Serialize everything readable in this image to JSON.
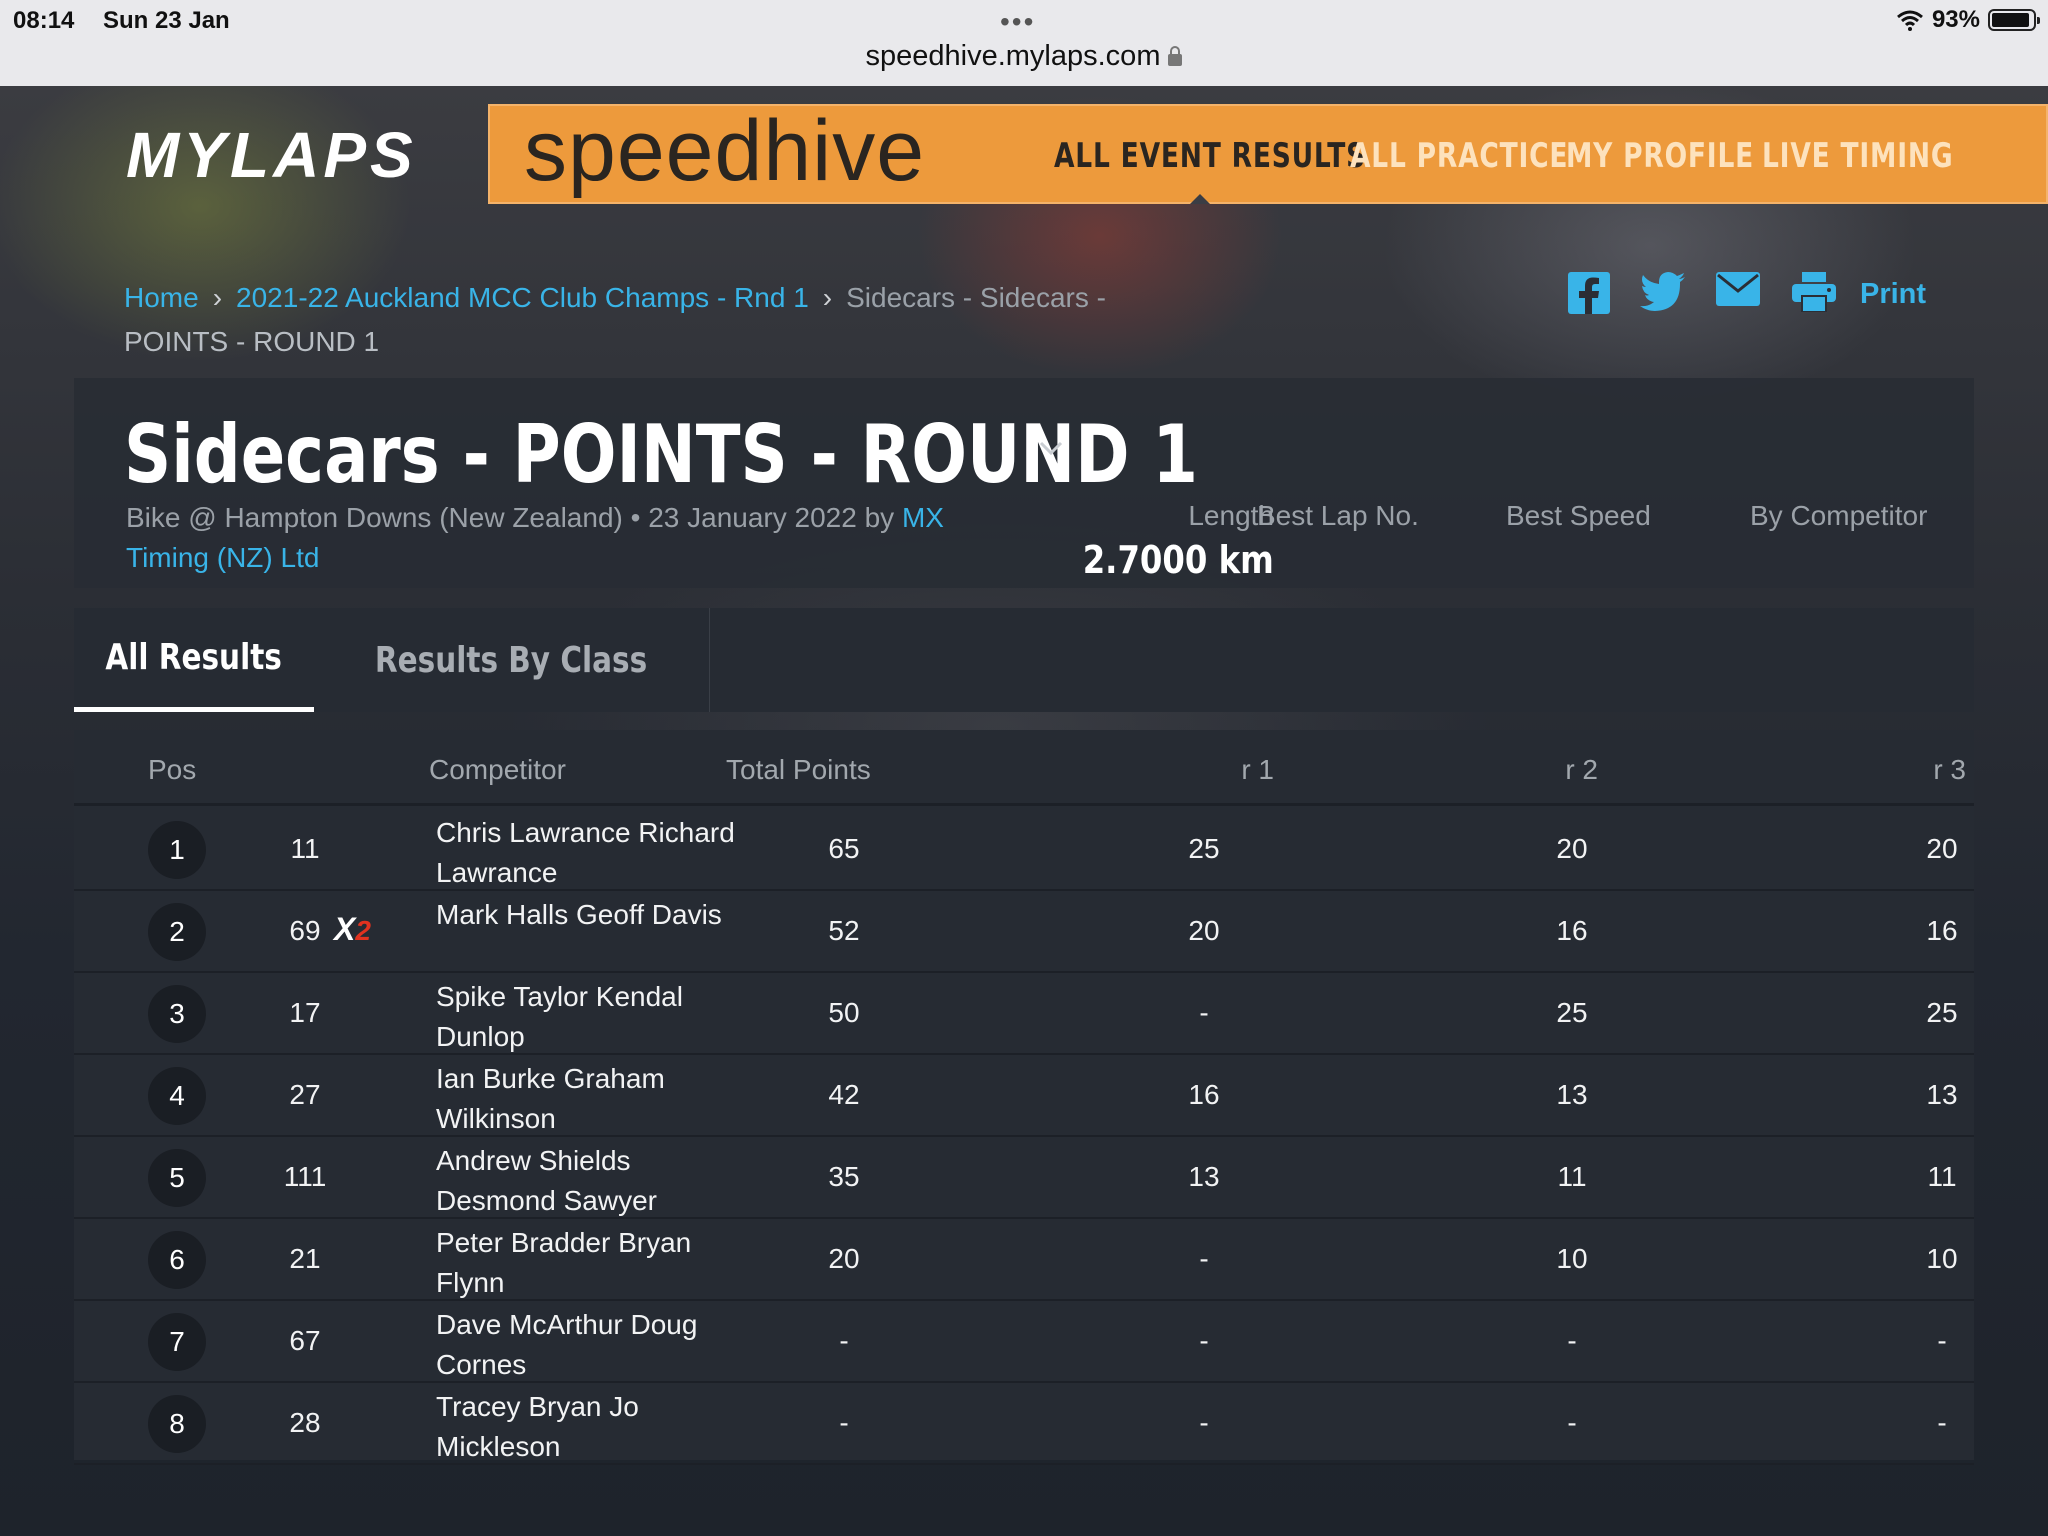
{
  "status_bar": {
    "time": "08:14",
    "date": "Sun 23 Jan",
    "dots": "•••",
    "battery": "93%",
    "battery_level": 0.93
  },
  "browser": {
    "url": "speedhive.mylaps.com"
  },
  "header": {
    "brand": "MYLAPS",
    "product": "speedhive",
    "nav": [
      "ALL EVENT RESULTS",
      "ALL PRACTICE",
      "MY PROFILE",
      "LIVE TIMING"
    ]
  },
  "breadcrumb": {
    "home": "Home",
    "event": "2021-22 Auckland MCC Club Champs - Rnd 1",
    "class": "Sidecars - Sidecars -",
    "current": "POINTS - ROUND 1"
  },
  "share": {
    "print_label": "Print"
  },
  "event": {
    "title": "Sidecars - POINTS - ROUND 1",
    "meta": "Bike @ Hampton Downs (New Zealand) • 23 January 2022 by",
    "organizer": "MX Timing (NZ) Ltd",
    "stats": {
      "length_label": "Length",
      "length_value": "2.7000 km",
      "best_lap_label": "Best Lap No.",
      "best_speed_label": "Best Speed",
      "by_competitor_label": "By Competitor"
    }
  },
  "tabs": [
    "All Results",
    "Results By Class"
  ],
  "table": {
    "headers": [
      "Pos",
      "Competitor",
      "Total Points",
      "r 1",
      "r 2",
      "r 3"
    ],
    "rows": [
      {
        "pos": "1",
        "number": "11",
        "badge": "",
        "badge_sub": "",
        "competitor": "Chris Lawrance Richard Lawrance",
        "total": "65",
        "r1": "25",
        "r2": "20",
        "r3": "20"
      },
      {
        "pos": "2",
        "number": "69",
        "badge": "X",
        "badge_sub": "2",
        "competitor": "Mark Halls Geoff Davis",
        "total": "52",
        "r1": "20",
        "r2": "16",
        "r3": "16"
      },
      {
        "pos": "3",
        "number": "17",
        "badge": "",
        "badge_sub": "",
        "competitor": "Spike Taylor Kendal Dunlop",
        "total": "50",
        "r1": "-",
        "r2": "25",
        "r3": "25"
      },
      {
        "pos": "4",
        "number": "27",
        "badge": "",
        "badge_sub": "",
        "competitor": "Ian Burke Graham Wilkinson",
        "total": "42",
        "r1": "16",
        "r2": "13",
        "r3": "13"
      },
      {
        "pos": "5",
        "number": "111",
        "badge": "",
        "badge_sub": "",
        "competitor": "Andrew Shields Desmond Sawyer",
        "total": "35",
        "r1": "13",
        "r2": "11",
        "r3": "11"
      },
      {
        "pos": "6",
        "number": "21",
        "badge": "",
        "badge_sub": "",
        "competitor": "Peter Bradder Bryan Flynn",
        "total": "20",
        "r1": "-",
        "r2": "10",
        "r3": "10"
      },
      {
        "pos": "7",
        "number": "67",
        "badge": "",
        "badge_sub": "",
        "competitor": "Dave McArthur Doug Cornes",
        "total": "-",
        "r1": "-",
        "r2": "-",
        "r3": "-"
      },
      {
        "pos": "8",
        "number": "28",
        "badge": "",
        "badge_sub": "",
        "competitor": "Tracey Bryan Jo Mickleson",
        "total": "-",
        "r1": "-",
        "r2": "-",
        "r3": "-"
      }
    ]
  },
  "colors": {
    "accent": "#ed9a3c",
    "link": "#39b4e8",
    "panel": "#262b33",
    "badge_red": "#e0321f"
  }
}
